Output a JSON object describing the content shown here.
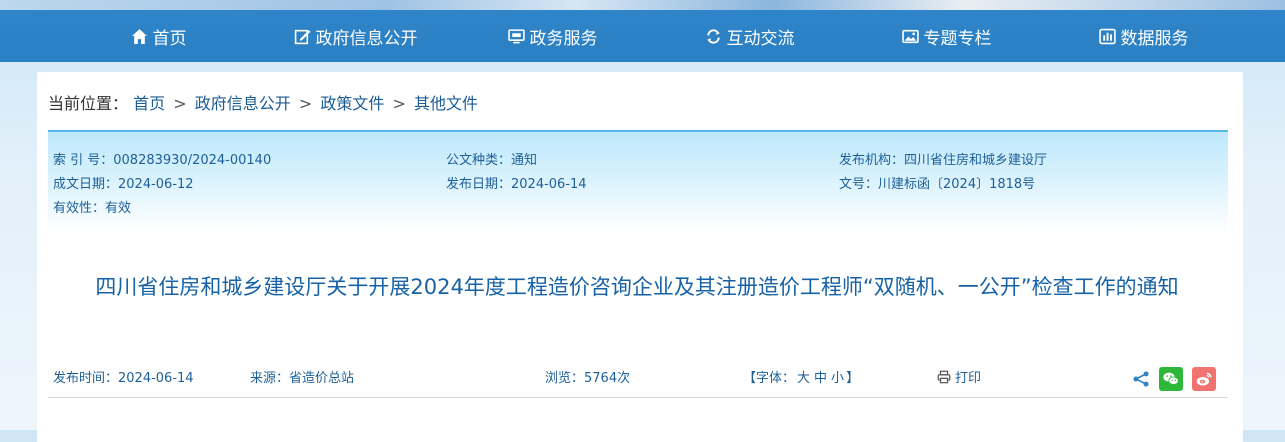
{
  "nav": {
    "items": [
      {
        "label": "首页",
        "icon": "home-icon"
      },
      {
        "label": "政府信息公开",
        "icon": "edit-icon"
      },
      {
        "label": "政务服务",
        "icon": "monitor-icon"
      },
      {
        "label": "互动交流",
        "icon": "exchange-icon"
      },
      {
        "label": "专题专栏",
        "icon": "image-icon"
      },
      {
        "label": "数据服务",
        "icon": "chart-icon"
      }
    ]
  },
  "breadcrumb": {
    "prefix": "当前位置：",
    "items": [
      "首页",
      "政府信息公开",
      "政策文件",
      "其他文件"
    ],
    "separator": ">"
  },
  "meta": {
    "index_no": "索 引 号：008283930/2024-00140",
    "doc_type": "公文种类：通知",
    "issuer": "发布机构：四川省住房和城乡建设厅",
    "created": "成文日期：2024-06-12",
    "published": "发布日期：2024-06-14",
    "doc_no": "文号：川建标函〔2024〕1818号",
    "validity": "有效性：有效"
  },
  "article": {
    "title": "四川省住房和城乡建设厅关于开展2024年度工程造价咨询企业及其注册造价工程师“双随机、一公开”检查工作的通知"
  },
  "info": {
    "publish_time": "发布时间：2024-06-14",
    "source": "来源：省造价总站",
    "views": "浏览：5764次",
    "font_prefix": "【字体：",
    "font_large": "大",
    "font_medium": "中",
    "font_small": "小",
    "font_suffix": "】",
    "print": "打印"
  },
  "colors": {
    "nav_bg": "#2f85c8",
    "link": "#1d5f98",
    "title": "#1762a6",
    "wechat": "#2eb83a",
    "weibo": "#f0736f"
  }
}
